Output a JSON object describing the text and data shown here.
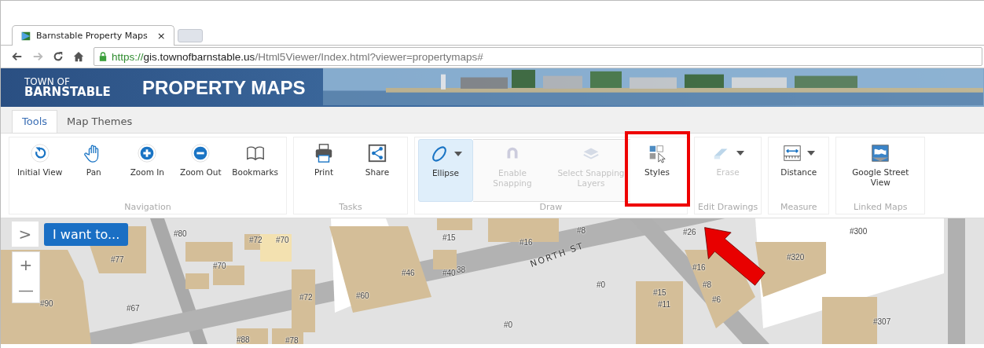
{
  "browser": {
    "tab_title": "Barnstable Property Maps",
    "tab_close": "×",
    "url": {
      "scheme": "https://",
      "host": "gis.townofbarnstable.us",
      "path": "/Html5Viewer/Index.html?viewer=propertymaps#"
    }
  },
  "banner": {
    "town_line1": "TOWN OF",
    "town_line2": "BARNSTABLE",
    "title": "PROPERTY MAPS"
  },
  "tabs": [
    {
      "label": "Tools",
      "selected": true
    },
    {
      "label": "Map Themes",
      "selected": false
    }
  ],
  "ribbon_groups": [
    {
      "label": "Navigation",
      "tools": [
        {
          "label": "Initial View",
          "disabled": false,
          "selected": false,
          "dropdown": false
        },
        {
          "label": "Pan",
          "disabled": false,
          "selected": false,
          "dropdown": false
        },
        {
          "label": "Zoom In",
          "disabled": false,
          "selected": false,
          "dropdown": false
        },
        {
          "label": "Zoom Out",
          "disabled": false,
          "selected": false,
          "dropdown": false
        },
        {
          "label": "Bookmarks",
          "disabled": false,
          "selected": false,
          "dropdown": false
        }
      ]
    },
    {
      "label": "Tasks",
      "tools": [
        {
          "label": "Print",
          "disabled": false,
          "selected": false,
          "dropdown": false
        },
        {
          "label": "Share",
          "disabled": false,
          "selected": false,
          "dropdown": false
        }
      ]
    },
    {
      "label": "Draw",
      "tools": [
        {
          "label": "Ellipse",
          "disabled": false,
          "selected": true,
          "dropdown": true
        },
        {
          "label": "Enable Snapping",
          "disabled": true,
          "selected": false,
          "dropdown": false
        },
        {
          "label": "Select Snapping Layers",
          "disabled": true,
          "selected": false,
          "dropdown": false
        },
        {
          "label": "Styles",
          "disabled": false,
          "selected": false,
          "dropdown": false,
          "highlighted": true
        }
      ]
    },
    {
      "label": "Edit Drawings",
      "tools": [
        {
          "label": "Erase",
          "disabled": true,
          "selected": false,
          "dropdown": true
        }
      ]
    },
    {
      "label": "Measure",
      "tools": [
        {
          "label": "Distance",
          "disabled": false,
          "selected": false,
          "dropdown": true
        }
      ]
    },
    {
      "label": "Linked Maps",
      "tools": [
        {
          "label": "Google Street View",
          "disabled": false,
          "selected": false,
          "dropdown": false
        }
      ]
    }
  ],
  "map": {
    "i_want_to": "I want to...",
    "zoom_in": "+",
    "zoom_out": "—",
    "expand": ">",
    "street_label": "NORTH ST",
    "pointer_arrow": true,
    "parcel_labels": [
      "#80",
      "#72",
      "#70",
      "#77",
      "#70",
      "#90",
      "#67",
      "#72",
      "#60",
      "#46",
      "#40",
      "38",
      "#15",
      "#16",
      "#8",
      "#0",
      "#26",
      "#16",
      "#8",
      "#6",
      "#15",
      "#11",
      "#320",
      "#300",
      "#307",
      "#88",
      "#78",
      "#0"
    ]
  }
}
